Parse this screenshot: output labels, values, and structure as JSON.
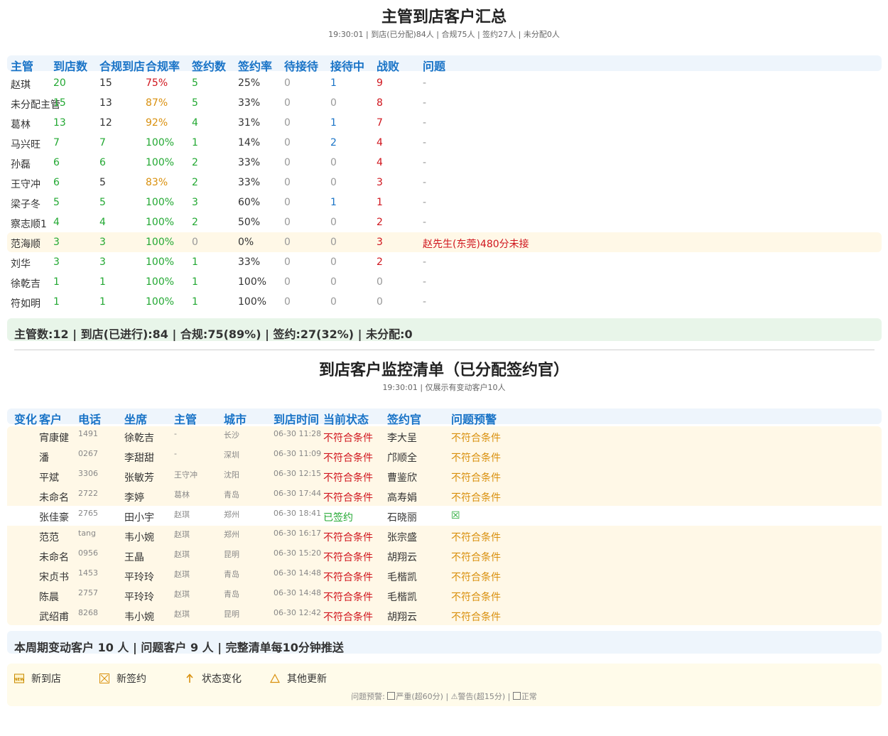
{
  "summary": {
    "title": "主管到店客户汇总",
    "subtitle": "19:30:01 | 到店(已分配)84人 | 合规75人 | 签约27人 | 未分配0人",
    "headers": [
      "主管",
      "到店数",
      "合规到店",
      "合规率",
      "签约数",
      "签约率",
      "待接待",
      "接待中",
      "战败",
      "问题"
    ],
    "rows": [
      [
        "赵琪",
        "20",
        "15",
        "75%",
        "5",
        "25%",
        "0",
        "1",
        "9",
        "-"
      ],
      [
        "未分配主管",
        "15",
        "13",
        "87%",
        "5",
        "33%",
        "0",
        "0",
        "8",
        "-"
      ],
      [
        "葛林",
        "13",
        "12",
        "92%",
        "4",
        "31%",
        "0",
        "1",
        "7",
        "-"
      ],
      [
        "马兴旺",
        "7",
        "7",
        "100%",
        "1",
        "14%",
        "0",
        "2",
        "4",
        "-"
      ],
      [
        "孙磊",
        "6",
        "6",
        "100%",
        "2",
        "33%",
        "0",
        "0",
        "4",
        "-"
      ],
      [
        "王守冲",
        "6",
        "5",
        "83%",
        "2",
        "33%",
        "0",
        "0",
        "3",
        "-"
      ],
      [
        "梁子冬",
        "5",
        "5",
        "100%",
        "3",
        "60%",
        "0",
        "1",
        "1",
        "-"
      ],
      [
        "察志顺1",
        "4",
        "4",
        "100%",
        "2",
        "50%",
        "0",
        "0",
        "2",
        "-"
      ],
      [
        "范海顺",
        "3",
        "3",
        "100%",
        "0",
        "0%",
        "0",
        "0",
        "3",
        "赵先生(东莞)480分未接"
      ],
      [
        "刘华",
        "3",
        "3",
        "100%",
        "1",
        "33%",
        "0",
        "0",
        "2",
        "-"
      ],
      [
        "徐乾吉",
        "1",
        "1",
        "100%",
        "1",
        "100%",
        "0",
        "0",
        "0",
        "-"
      ],
      [
        "符如明",
        "1",
        "1",
        "100%",
        "1",
        "100%",
        "0",
        "0",
        "0",
        "-"
      ]
    ],
    "footer": "主管数:12 | 到店(已进行):84 | 合规:75(89%) | 签约:27(32%) | 未分配:0"
  },
  "monitor": {
    "title": "到店客户监控清单（已分配签约官）",
    "subtitle": "19:30:01 | 仅展示有变动客户10人",
    "headers": [
      "变化",
      "客户",
      "电话",
      "坐席",
      "主管",
      "城市",
      "到店时间",
      "当前状态",
      "签约官",
      "问题预警"
    ],
    "rows": [
      [
        "",
        "宵康健",
        "1491",
        "徐乾吉",
        "-",
        "长沙",
        "06-30 11:28",
        "不符合条件",
        "李大呈",
        "不符合条件"
      ],
      [
        "",
        "潘",
        "0267",
        "李甜甜",
        "-",
        "深圳",
        "06-30 11:09",
        "不符合条件",
        "邝顺全",
        "不符合条件"
      ],
      [
        "",
        "平斌",
        "3306",
        "张敏芳",
        "王守冲",
        "沈阳",
        "06-30 12:15",
        "不符合条件",
        "曹鉴欣",
        "不符合条件"
      ],
      [
        "",
        "未命名",
        "2722",
        "李婷",
        "葛林",
        "青岛",
        "06-30 17:44",
        "不符合条件",
        "高寿娟",
        "不符合条件"
      ],
      [
        "",
        "张佳豪",
        "2765",
        "田小宇",
        "赵琪",
        "郑州",
        "06-30 18:41",
        "已签约",
        "石晓丽",
        "☒"
      ],
      [
        "",
        "范范",
        "tang",
        "韦小婉",
        "赵琪",
        "郑州",
        "06-30 16:17",
        "不符合条件",
        "张宗盛",
        "不符合条件"
      ],
      [
        "",
        "未命名",
        "0956",
        "王晶",
        "赵琪",
        "昆明",
        "06-30 15:20",
        "不符合条件",
        "胡翔云",
        "不符合条件"
      ],
      [
        "",
        "宋贞书",
        "1453",
        "平玲玲",
        "赵琪",
        "青岛",
        "06-30 14:48",
        "不符合条件",
        "毛楷凯",
        "不符合条件"
      ],
      [
        "",
        "陈晨",
        "2757",
        "平玲玲",
        "赵琪",
        "青岛",
        "06-30 14:48",
        "不符合条件",
        "毛楷凯",
        "不符合条件"
      ],
      [
        "",
        "武绍甫",
        "8268",
        "韦小婉",
        "赵琪",
        "昆明",
        "06-30 12:42",
        "不符合条件",
        "胡翔云",
        "不符合条件"
      ]
    ],
    "footer": "本周期变动客户 10 人 | 问题客户 9 人 | 完整清单每10分钟推送"
  },
  "legend": {
    "items": [
      {
        "icon": "new-badge-icon",
        "label": "新到店"
      },
      {
        "icon": "boxed-x-icon",
        "label": "新签约"
      },
      {
        "icon": "up-arrow-icon",
        "label": "状态变化"
      },
      {
        "icon": "triangle-icon",
        "label": "其他更新"
      }
    ],
    "warn_prefix": "问题预警: ",
    "warn_severe": "严重(超60分) | ",
    "warn_alert": "⚠警告(超15分) | ",
    "warn_normal": "正常"
  },
  "colors": {
    "header_blue": "#1a74c7",
    "good_green": "#22a832",
    "bad_red": "#d0161e",
    "warn_orange": "#d9900e",
    "row_highlight": "#fff8e7",
    "summary_green_bg": "#e8f5e9",
    "header_bar_bg": "#eef5fc"
  }
}
